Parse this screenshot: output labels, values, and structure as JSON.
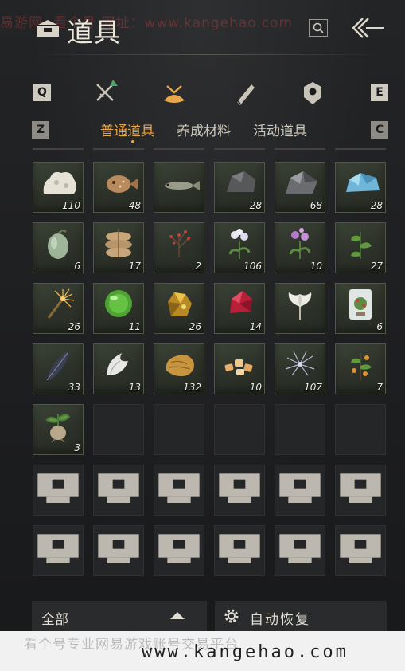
{
  "header": {
    "title": "道具",
    "watermark": "易游网: 看个号  网址：www.kangehao.com"
  },
  "keys": {
    "q": "Q",
    "e": "E",
    "z": "Z",
    "c": "C"
  },
  "subtabs": [
    "普通道具",
    "养成材料",
    "活动道具"
  ],
  "items": [
    {
      "icon": "coral-icon",
      "count": "110"
    },
    {
      "icon": "pufferfish-icon",
      "count": "48"
    },
    {
      "icon": "fish-icon",
      "count": ""
    },
    {
      "icon": "dark-ore-icon",
      "count": "28"
    },
    {
      "icon": "iron-ore-icon",
      "count": "68"
    },
    {
      "icon": "blue-crystal-icon",
      "count": "28"
    },
    {
      "icon": "gourd-icon",
      "count": "6"
    },
    {
      "icon": "sack-icon",
      "count": "17"
    },
    {
      "icon": "red-berry-herb-icon",
      "count": "2"
    },
    {
      "icon": "white-flower-icon",
      "count": "106"
    },
    {
      "icon": "purple-flower-icon",
      "count": "10"
    },
    {
      "icon": "green-herb-icon",
      "count": "27"
    },
    {
      "icon": "firework-icon",
      "count": "26"
    },
    {
      "icon": "jade-orb-icon",
      "count": "11"
    },
    {
      "icon": "gold-ore-icon",
      "count": "26"
    },
    {
      "icon": "red-crystal-icon",
      "count": "14"
    },
    {
      "icon": "white-lily-icon",
      "count": ""
    },
    {
      "icon": "bonsai-icon",
      "count": "6"
    },
    {
      "icon": "feather-icon",
      "count": "33"
    },
    {
      "icon": "white-fur-icon",
      "count": "13"
    },
    {
      "icon": "gold-nugget-icon",
      "count": "132"
    },
    {
      "icon": "amber-pieces-icon",
      "count": "10"
    },
    {
      "icon": "spider-flower-icon",
      "count": "107"
    },
    {
      "icon": "orange-branch-icon",
      "count": "7"
    },
    {
      "icon": "root-plant-icon",
      "count": "3"
    }
  ],
  "filter": {
    "label": "全部"
  },
  "auto": {
    "label": "自动恢复"
  },
  "watermark_bottom": {
    "cn": "看个号专业网易游戏账号交易平台",
    "url": "www.kangehao.com"
  },
  "colors": {
    "accent": "#e7a64b",
    "cell_filled": "#2c3129",
    "text": "#d9d4c6"
  }
}
